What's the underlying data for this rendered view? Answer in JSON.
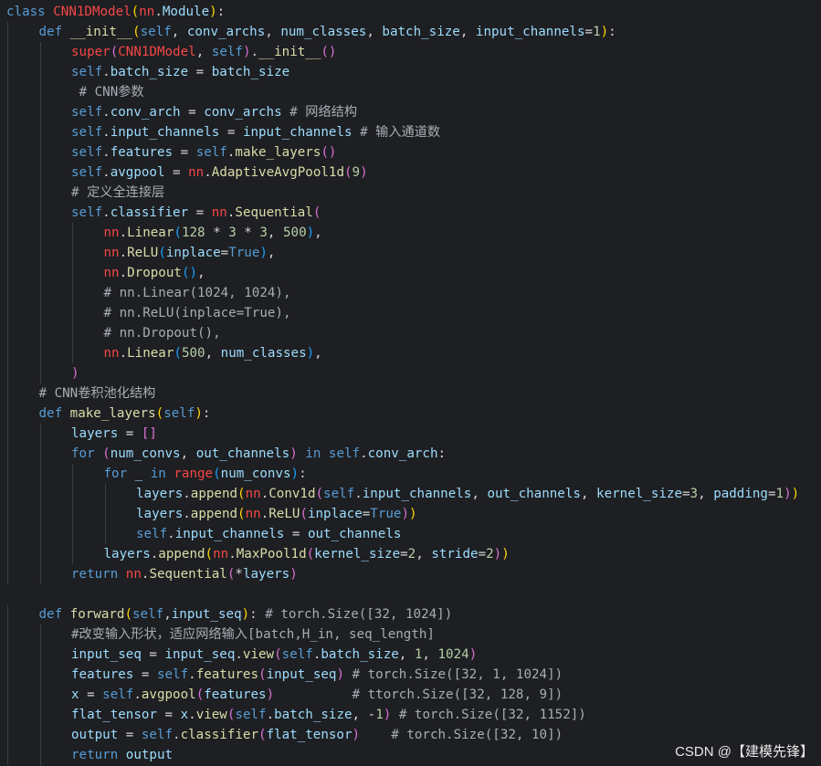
{
  "watermark": "CSDN @【建模先锋】",
  "lines": [
    {
      "indent": 0,
      "tokens": [
        [
          "t-kw",
          "class "
        ],
        [
          "t-cls",
          "CNN1DModel"
        ],
        [
          "t-paren",
          "("
        ],
        [
          "t-mod",
          "nn"
        ],
        [
          "t-txt",
          "."
        ],
        [
          "t-attr",
          "Module"
        ],
        [
          "t-paren",
          ")"
        ],
        [
          "t-txt",
          ":"
        ]
      ]
    },
    {
      "indent": 1,
      "tokens": [
        [
          "t-kw",
          "def "
        ],
        [
          "t-def",
          "__init__"
        ],
        [
          "t-paren",
          "("
        ],
        [
          "t-self",
          "self"
        ],
        [
          "t-txt",
          ", "
        ],
        [
          "t-param",
          "conv_archs"
        ],
        [
          "t-txt",
          ", "
        ],
        [
          "t-param",
          "num_classes"
        ],
        [
          "t-txt",
          ", "
        ],
        [
          "t-param",
          "batch_size"
        ],
        [
          "t-txt",
          ", "
        ],
        [
          "t-param",
          "input_channels"
        ],
        [
          "t-op",
          "="
        ],
        [
          "t-num",
          "1"
        ],
        [
          "t-paren",
          ")"
        ],
        [
          "t-txt",
          ":"
        ]
      ]
    },
    {
      "indent": 2,
      "tokens": [
        [
          "t-cls",
          "super"
        ],
        [
          "t-paren2",
          "("
        ],
        [
          "t-cls",
          "CNN1DModel"
        ],
        [
          "t-txt",
          ", "
        ],
        [
          "t-self",
          "self"
        ],
        [
          "t-paren2",
          ")"
        ],
        [
          "t-txt",
          "."
        ],
        [
          "t-fn",
          "__init__"
        ],
        [
          "t-paren2",
          "()"
        ]
      ]
    },
    {
      "indent": 2,
      "tokens": [
        [
          "t-self",
          "self"
        ],
        [
          "t-txt",
          "."
        ],
        [
          "t-attr",
          "batch_size"
        ],
        [
          "t-op",
          " = "
        ],
        [
          "t-param",
          "batch_size"
        ]
      ]
    },
    {
      "indent": 2,
      "tokens": [
        [
          "t-cmt",
          " # CNN参数"
        ]
      ]
    },
    {
      "indent": 2,
      "tokens": [
        [
          "t-self",
          "self"
        ],
        [
          "t-txt",
          "."
        ],
        [
          "t-attr",
          "conv_arch"
        ],
        [
          "t-op",
          " = "
        ],
        [
          "t-param",
          "conv_archs"
        ],
        [
          "t-cmt",
          " # 网络结构"
        ]
      ]
    },
    {
      "indent": 2,
      "tokens": [
        [
          "t-self",
          "self"
        ],
        [
          "t-txt",
          "."
        ],
        [
          "t-attr",
          "input_channels"
        ],
        [
          "t-op",
          " = "
        ],
        [
          "t-param",
          "input_channels"
        ],
        [
          "t-cmt",
          " # 输入通道数"
        ]
      ]
    },
    {
      "indent": 2,
      "tokens": [
        [
          "t-self",
          "self"
        ],
        [
          "t-txt",
          "."
        ],
        [
          "t-attr",
          "features"
        ],
        [
          "t-op",
          " = "
        ],
        [
          "t-self",
          "self"
        ],
        [
          "t-txt",
          "."
        ],
        [
          "t-fn",
          "make_layers"
        ],
        [
          "t-paren2",
          "()"
        ]
      ]
    },
    {
      "indent": 2,
      "tokens": [
        [
          "t-self",
          "self"
        ],
        [
          "t-txt",
          "."
        ],
        [
          "t-attr",
          "avgpool"
        ],
        [
          "t-op",
          " = "
        ],
        [
          "t-mod",
          "nn"
        ],
        [
          "t-txt",
          "."
        ],
        [
          "t-fn",
          "AdaptiveAvgPool1d"
        ],
        [
          "t-paren2",
          "("
        ],
        [
          "t-num",
          "9"
        ],
        [
          "t-paren2",
          ")"
        ]
      ]
    },
    {
      "indent": 2,
      "tokens": [
        [
          "t-cmt",
          "# 定义全连接层"
        ]
      ]
    },
    {
      "indent": 2,
      "tokens": [
        [
          "t-self",
          "self"
        ],
        [
          "t-txt",
          "."
        ],
        [
          "t-attr",
          "classifier"
        ],
        [
          "t-op",
          " = "
        ],
        [
          "t-mod",
          "nn"
        ],
        [
          "t-txt",
          "."
        ],
        [
          "t-fn",
          "Sequential"
        ],
        [
          "t-paren2",
          "("
        ]
      ]
    },
    {
      "indent": 3,
      "tokens": [
        [
          "t-mod",
          "nn"
        ],
        [
          "t-txt",
          "."
        ],
        [
          "t-fn",
          "Linear"
        ],
        [
          "t-paren3",
          "("
        ],
        [
          "t-num",
          "128"
        ],
        [
          "t-op",
          " * "
        ],
        [
          "t-num",
          "3"
        ],
        [
          "t-op",
          " * "
        ],
        [
          "t-num",
          "3"
        ],
        [
          "t-txt",
          ", "
        ],
        [
          "t-num",
          "500"
        ],
        [
          "t-paren3",
          ")"
        ],
        [
          "t-txt",
          ","
        ]
      ]
    },
    {
      "indent": 3,
      "tokens": [
        [
          "t-mod",
          "nn"
        ],
        [
          "t-txt",
          "."
        ],
        [
          "t-fn",
          "ReLU"
        ],
        [
          "t-paren3",
          "("
        ],
        [
          "t-param",
          "inplace"
        ],
        [
          "t-op",
          "="
        ],
        [
          "t-bool",
          "True"
        ],
        [
          "t-paren3",
          ")"
        ],
        [
          "t-txt",
          ","
        ]
      ]
    },
    {
      "indent": 3,
      "tokens": [
        [
          "t-mod",
          "nn"
        ],
        [
          "t-txt",
          "."
        ],
        [
          "t-fn",
          "Dropout"
        ],
        [
          "t-paren3",
          "()"
        ],
        [
          "t-txt",
          ","
        ]
      ]
    },
    {
      "indent": 3,
      "tokens": [
        [
          "t-cmt",
          "# nn.Linear(1024, 1024),"
        ]
      ]
    },
    {
      "indent": 3,
      "tokens": [
        [
          "t-cmt",
          "# nn.ReLU(inplace=True),"
        ]
      ]
    },
    {
      "indent": 3,
      "tokens": [
        [
          "t-cmt",
          "# nn.Dropout(),"
        ]
      ]
    },
    {
      "indent": 3,
      "tokens": [
        [
          "t-mod",
          "nn"
        ],
        [
          "t-txt",
          "."
        ],
        [
          "t-fn",
          "Linear"
        ],
        [
          "t-paren3",
          "("
        ],
        [
          "t-num",
          "500"
        ],
        [
          "t-txt",
          ", "
        ],
        [
          "t-param",
          "num_classes"
        ],
        [
          "t-paren3",
          ")"
        ],
        [
          "t-txt",
          ","
        ]
      ]
    },
    {
      "indent": 2,
      "tokens": [
        [
          "t-paren2",
          ")"
        ]
      ]
    },
    {
      "indent": 1,
      "tokens": [
        [
          "t-cmt",
          "# CNN卷积池化结构"
        ]
      ]
    },
    {
      "indent": 1,
      "tokens": [
        [
          "t-kw",
          "def "
        ],
        [
          "t-def",
          "make_layers"
        ],
        [
          "t-paren",
          "("
        ],
        [
          "t-self",
          "self"
        ],
        [
          "t-paren",
          ")"
        ],
        [
          "t-txt",
          ":"
        ]
      ]
    },
    {
      "indent": 2,
      "tokens": [
        [
          "t-param",
          "layers"
        ],
        [
          "t-op",
          " = "
        ],
        [
          "t-paren2",
          "[]"
        ]
      ]
    },
    {
      "indent": 2,
      "tokens": [
        [
          "t-kw",
          "for "
        ],
        [
          "t-paren2",
          "("
        ],
        [
          "t-param",
          "num_convs"
        ],
        [
          "t-txt",
          ", "
        ],
        [
          "t-param",
          "out_channels"
        ],
        [
          "t-paren2",
          ")"
        ],
        [
          "t-kw",
          " in "
        ],
        [
          "t-self",
          "self"
        ],
        [
          "t-txt",
          "."
        ],
        [
          "t-attr",
          "conv_arch"
        ],
        [
          "t-txt",
          ":"
        ]
      ]
    },
    {
      "indent": 3,
      "tokens": [
        [
          "t-kw",
          "for "
        ],
        [
          "t-param",
          "_"
        ],
        [
          "t-kw",
          " in "
        ],
        [
          "t-cls",
          "range"
        ],
        [
          "t-paren3",
          "("
        ],
        [
          "t-param",
          "num_convs"
        ],
        [
          "t-paren3",
          ")"
        ],
        [
          "t-txt",
          ":"
        ]
      ]
    },
    {
      "indent": 4,
      "tokens": [
        [
          "t-param",
          "layers"
        ],
        [
          "t-txt",
          "."
        ],
        [
          "t-fn",
          "append"
        ],
        [
          "t-paren",
          "("
        ],
        [
          "t-mod",
          "nn"
        ],
        [
          "t-txt",
          "."
        ],
        [
          "t-fn",
          "Conv1d"
        ],
        [
          "t-paren2",
          "("
        ],
        [
          "t-self",
          "self"
        ],
        [
          "t-txt",
          "."
        ],
        [
          "t-attr",
          "input_channels"
        ],
        [
          "t-txt",
          ", "
        ],
        [
          "t-param",
          "out_channels"
        ],
        [
          "t-txt",
          ", "
        ],
        [
          "t-param",
          "kernel_size"
        ],
        [
          "t-op",
          "="
        ],
        [
          "t-num",
          "3"
        ],
        [
          "t-txt",
          ", "
        ],
        [
          "t-param",
          "padding"
        ],
        [
          "t-op",
          "="
        ],
        [
          "t-num",
          "1"
        ],
        [
          "t-paren2",
          ")"
        ],
        [
          "t-paren",
          ")"
        ]
      ]
    },
    {
      "indent": 4,
      "tokens": [
        [
          "t-param",
          "layers"
        ],
        [
          "t-txt",
          "."
        ],
        [
          "t-fn",
          "append"
        ],
        [
          "t-paren",
          "("
        ],
        [
          "t-mod",
          "nn"
        ],
        [
          "t-txt",
          "."
        ],
        [
          "t-fn",
          "ReLU"
        ],
        [
          "t-paren2",
          "("
        ],
        [
          "t-param",
          "inplace"
        ],
        [
          "t-op",
          "="
        ],
        [
          "t-bool",
          "True"
        ],
        [
          "t-paren2",
          ")"
        ],
        [
          "t-paren",
          ")"
        ]
      ]
    },
    {
      "indent": 4,
      "tokens": [
        [
          "t-self",
          "self"
        ],
        [
          "t-txt",
          "."
        ],
        [
          "t-attr",
          "input_channels"
        ],
        [
          "t-op",
          " = "
        ],
        [
          "t-param",
          "out_channels"
        ]
      ]
    },
    {
      "indent": 3,
      "tokens": [
        [
          "t-param",
          "layers"
        ],
        [
          "t-txt",
          "."
        ],
        [
          "t-fn",
          "append"
        ],
        [
          "t-paren",
          "("
        ],
        [
          "t-mod",
          "nn"
        ],
        [
          "t-txt",
          "."
        ],
        [
          "t-fn",
          "MaxPool1d"
        ],
        [
          "t-paren2",
          "("
        ],
        [
          "t-param",
          "kernel_size"
        ],
        [
          "t-op",
          "="
        ],
        [
          "t-num",
          "2"
        ],
        [
          "t-txt",
          ", "
        ],
        [
          "t-param",
          "stride"
        ],
        [
          "t-op",
          "="
        ],
        [
          "t-num",
          "2"
        ],
        [
          "t-paren2",
          ")"
        ],
        [
          "t-paren",
          ")"
        ]
      ]
    },
    {
      "indent": 2,
      "tokens": [
        [
          "t-kw",
          "return "
        ],
        [
          "t-mod",
          "nn"
        ],
        [
          "t-txt",
          "."
        ],
        [
          "t-fn",
          "Sequential"
        ],
        [
          "t-paren2",
          "("
        ],
        [
          "t-star",
          "*"
        ],
        [
          "t-param",
          "layers"
        ],
        [
          "t-paren2",
          ")"
        ]
      ]
    },
    {
      "indent": 0,
      "tokens": []
    },
    {
      "indent": 1,
      "tokens": [
        [
          "t-kw",
          "def "
        ],
        [
          "t-def",
          "forward"
        ],
        [
          "t-paren",
          "("
        ],
        [
          "t-self",
          "self"
        ],
        [
          "t-txt",
          ","
        ],
        [
          "t-param",
          "input_seq"
        ],
        [
          "t-paren",
          ")"
        ],
        [
          "t-txt",
          ":"
        ],
        [
          "t-cmt",
          " # torch.Size([32, 1024])"
        ]
      ]
    },
    {
      "indent": 2,
      "tokens": [
        [
          "t-cmt",
          "#改变输入形状，适应网络输入[batch,H_in, seq_length]"
        ]
      ]
    },
    {
      "indent": 2,
      "tokens": [
        [
          "t-param",
          "input_seq"
        ],
        [
          "t-op",
          " = "
        ],
        [
          "t-param",
          "input_seq"
        ],
        [
          "t-txt",
          "."
        ],
        [
          "t-fn",
          "view"
        ],
        [
          "t-paren2",
          "("
        ],
        [
          "t-self",
          "self"
        ],
        [
          "t-txt",
          "."
        ],
        [
          "t-attr",
          "batch_size"
        ],
        [
          "t-txt",
          ", "
        ],
        [
          "t-num",
          "1"
        ],
        [
          "t-txt",
          ", "
        ],
        [
          "t-num",
          "1024"
        ],
        [
          "t-paren2",
          ")"
        ]
      ]
    },
    {
      "indent": 2,
      "tokens": [
        [
          "t-param",
          "features"
        ],
        [
          "t-op",
          " = "
        ],
        [
          "t-self",
          "self"
        ],
        [
          "t-txt",
          "."
        ],
        [
          "t-fn",
          "features"
        ],
        [
          "t-paren2",
          "("
        ],
        [
          "t-param",
          "input_seq"
        ],
        [
          "t-paren2",
          ")"
        ],
        [
          "t-cmt",
          " # torch.Size([32, 1, 1024])"
        ]
      ]
    },
    {
      "indent": 2,
      "tokens": [
        [
          "t-param",
          "x"
        ],
        [
          "t-op",
          " = "
        ],
        [
          "t-self",
          "self"
        ],
        [
          "t-txt",
          "."
        ],
        [
          "t-fn",
          "avgpool"
        ],
        [
          "t-paren2",
          "("
        ],
        [
          "t-param",
          "features"
        ],
        [
          "t-paren2",
          ")"
        ],
        [
          "t-cmt",
          "          # ttorch.Size([32, 128, 9])"
        ]
      ]
    },
    {
      "indent": 2,
      "tokens": [
        [
          "t-param",
          "flat_tensor"
        ],
        [
          "t-op",
          " = "
        ],
        [
          "t-param",
          "x"
        ],
        [
          "t-txt",
          "."
        ],
        [
          "t-fn",
          "view"
        ],
        [
          "t-paren2",
          "("
        ],
        [
          "t-self",
          "self"
        ],
        [
          "t-txt",
          "."
        ],
        [
          "t-attr",
          "batch_size"
        ],
        [
          "t-txt",
          ", "
        ],
        [
          "t-op",
          "-"
        ],
        [
          "t-num",
          "1"
        ],
        [
          "t-paren2",
          ")"
        ],
        [
          "t-cmt",
          " # torch.Size([32, 1152])"
        ]
      ]
    },
    {
      "indent": 2,
      "tokens": [
        [
          "t-param",
          "output"
        ],
        [
          "t-op",
          " = "
        ],
        [
          "t-self",
          "self"
        ],
        [
          "t-txt",
          "."
        ],
        [
          "t-fn",
          "classifier"
        ],
        [
          "t-paren2",
          "("
        ],
        [
          "t-param",
          "flat_tensor"
        ],
        [
          "t-paren2",
          ")"
        ],
        [
          "t-cmt",
          "    # torch.Size([32, 10])"
        ]
      ]
    },
    {
      "indent": 2,
      "tokens": [
        [
          "t-kw",
          "return "
        ],
        [
          "t-param",
          "output"
        ]
      ]
    }
  ]
}
